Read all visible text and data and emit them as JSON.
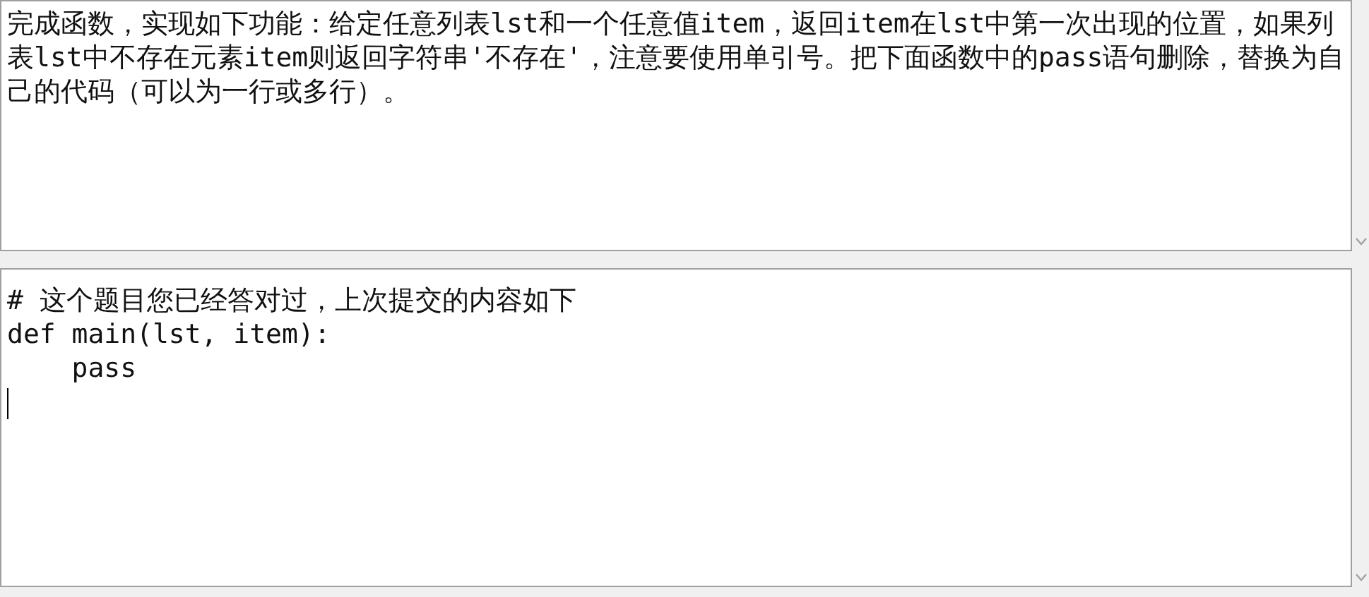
{
  "question": {
    "text": "完成函数，实现如下功能：给定任意列表lst和一个任意值item，返回item在lst中第一次出现的位置，如果列表lst中不存在元素item则返回字符串'不存在'，注意要使用单引号。把下面函数中的pass语句删除，替换为自己的代码（可以为一行或多行）。"
  },
  "answer": {
    "lines": [
      "# 这个题目您已经答对过，上次提交的内容如下",
      "def main(lst, item):",
      "    pass"
    ]
  }
}
